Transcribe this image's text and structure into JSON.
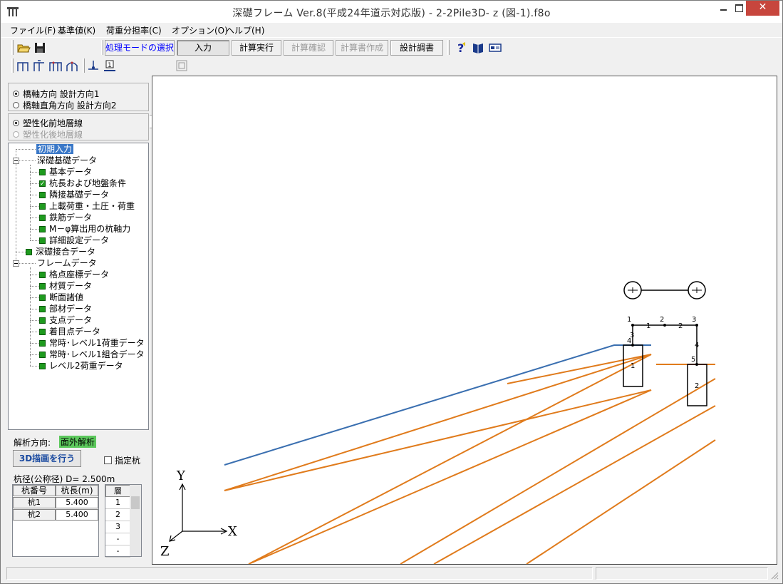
{
  "window": {
    "title": "深礎フレーム Ver.8(平成24年道示対応版) - 2-2Pile3D- z (図-1).f8o"
  },
  "menu": {
    "items": [
      "ファイル(F)",
      "基準値(K)",
      "荷重分担率(C)",
      "オプション(O)",
      "ヘルプ(H)"
    ]
  },
  "toolbar": {
    "mode_label": "処理モードの選択",
    "buttons": [
      "入力",
      "計算実行",
      "計算確認",
      "計算書作成",
      "設計調書"
    ],
    "combo_value": ""
  },
  "left": {
    "direction_radios": [
      {
        "label": "橋軸方向 設計方向1",
        "checked": true
      },
      {
        "label": "橋軸直角方向 設計方向2",
        "checked": false
      }
    ],
    "ground_radios": [
      {
        "label": "塑性化前地層線",
        "checked": true
      },
      {
        "label": "塑性化後地層線",
        "checked": false
      }
    ],
    "tree": {
      "initial": "初期入力",
      "group1": "深礎基礎データ",
      "group1_items": [
        "基本データ",
        "杭長および地盤条件",
        "隣接基礎データ",
        "上載荷重・土圧・荷重",
        "鉄筋データ",
        "M－φ算出用の杭軸力",
        "詳細設定データ"
      ],
      "joint": "深礎接合データ",
      "group2": "フレームデータ",
      "group2_items": [
        "格点座標データ",
        "材質データ",
        "断面諸値",
        "部材データ",
        "支点データ",
        "着目点データ",
        "常時･レベル1荷重データ",
        "常時･レベル1組合データ",
        "レベル2荷重データ"
      ]
    },
    "analysis_label": "解析方向:",
    "analysis_value": "面外解析",
    "draw3d_button": "3D描画を行う",
    "specified_pile_label": "指定杭",
    "pile_diameter": "杭径(公称径) D= 2.500m",
    "pile_table": {
      "headers": [
        "杭番号",
        "杭長(m)"
      ],
      "rows": [
        [
          "杭1",
          "5.400"
        ],
        [
          "杭2",
          "5.400"
        ]
      ]
    },
    "layer_table": {
      "header": "層",
      "rows": [
        "1",
        "2",
        "3",
        "-",
        "-"
      ]
    }
  },
  "drawing": {
    "axis_labels": {
      "y": "Y",
      "x": "X",
      "z": "Z"
    },
    "node_labels": [
      "1",
      "2",
      "3",
      "1",
      "2",
      "3",
      "4",
      "4",
      "5"
    ],
    "pile_labels": [
      "1",
      "2"
    ],
    "colors": {
      "ground_line": "#3a6fb0",
      "layer_lines": "#e07b1c",
      "frame": "#000000"
    }
  }
}
